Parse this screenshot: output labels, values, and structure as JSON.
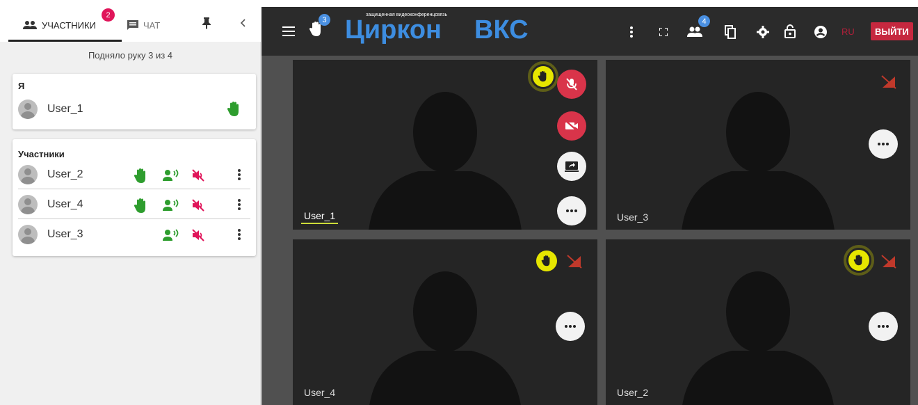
{
  "sidebar": {
    "tabs": [
      {
        "label": "УЧАСТНИКИ",
        "badge": "2",
        "icon": "people-icon"
      },
      {
        "label": "ЧАТ",
        "icon": "chat-icon"
      }
    ],
    "raised_status": "Подняло руку 3 из 4",
    "me_card": {
      "title": "Я",
      "user": {
        "name": "User_1",
        "hand_raised": true
      }
    },
    "participants_card": {
      "title": "Участники",
      "rows": [
        {
          "name": "User_2",
          "hand_raised": true,
          "speaking": true,
          "muted": true
        },
        {
          "name": "User_4",
          "hand_raised": true,
          "speaking": true,
          "muted": true
        },
        {
          "name": "User_3",
          "hand_raised": false,
          "speaking": true,
          "muted": true
        }
      ]
    }
  },
  "topbar": {
    "hand_count": "3",
    "logo_small_text": "защищенная видеоконференцсвязь",
    "logo_text_left": "Циркон",
    "logo_text_right": "ВКС",
    "participants_count": "4",
    "lang": "RU",
    "logout_label": "ВЫЙТИ"
  },
  "tiles": [
    {
      "name": "User_1",
      "active": true,
      "hand_raised": true
    },
    {
      "name": "User_3",
      "active": false,
      "hand_raised": false
    },
    {
      "name": "User_4",
      "active": false,
      "hand_raised": true
    },
    {
      "name": "User_2",
      "active": false,
      "hand_raised": true
    }
  ],
  "colors": {
    "accent_red": "#d9344a",
    "hand_green": "#2e9d2e",
    "hand_yellow": "#e6e600",
    "badge_blue": "#4a90e2",
    "badge_pink": "#e0155a"
  }
}
